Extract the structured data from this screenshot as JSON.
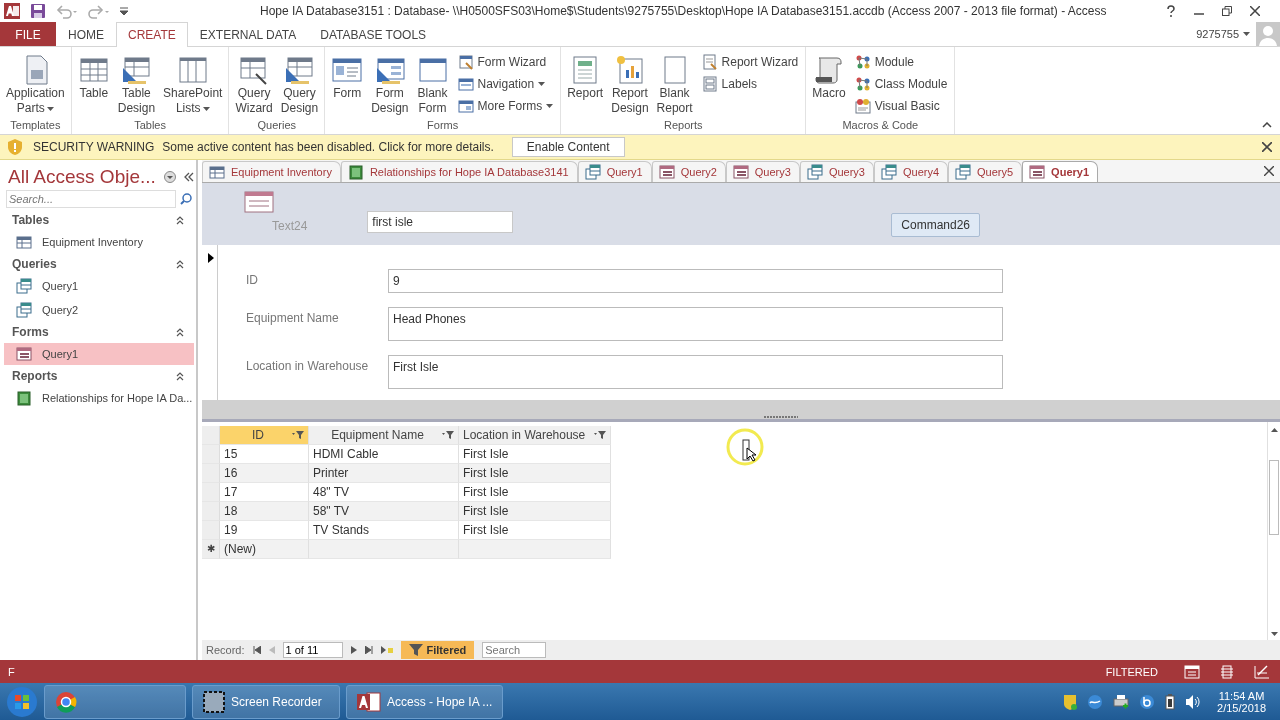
{
  "window": {
    "title": "Hope IA Database3151 : Database- \\\\H0500SFS03\\Home$\\Students\\9275755\\Desktop\\Hope IA Database3151.accdb (Access 2007 - 2013 file format) - Access",
    "user": "9275755"
  },
  "ribbon_tabs": [
    {
      "label": "FILE",
      "kind": "file",
      "selected": false
    },
    {
      "label": "HOME",
      "kind": "tab",
      "selected": false
    },
    {
      "label": "CREATE",
      "kind": "tab",
      "selected": true
    },
    {
      "label": "EXTERNAL DATA",
      "kind": "tab",
      "selected": false
    },
    {
      "label": "DATABASE TOOLS",
      "kind": "tab",
      "selected": false
    }
  ],
  "ribbon_groups": [
    {
      "label": "Templates",
      "large": [
        {
          "label": "Application\nParts",
          "dropdown": true,
          "kind": "parts"
        }
      ]
    },
    {
      "label": "Tables",
      "large": [
        {
          "label": "Table",
          "dropdown": false,
          "kind": "table"
        },
        {
          "label": "Table\nDesign",
          "dropdown": false,
          "kind": "tabledesign"
        },
        {
          "label": "SharePoint\nLists",
          "dropdown": true,
          "kind": "lists"
        }
      ]
    },
    {
      "label": "Queries",
      "large": [
        {
          "label": "Query\nWizard",
          "dropdown": false,
          "kind": "querywizard"
        },
        {
          "label": "Query\nDesign",
          "dropdown": false,
          "kind": "tabledesign"
        }
      ]
    },
    {
      "label": "Forms",
      "large": [
        {
          "label": "Form",
          "dropdown": false,
          "kind": "form"
        },
        {
          "label": "Form\nDesign",
          "dropdown": false,
          "kind": "formdesign"
        },
        {
          "label": "Blank\nForm",
          "dropdown": false,
          "kind": "blank"
        }
      ],
      "small": [
        {
          "label": "Form Wizard",
          "dropdown": false
        },
        {
          "label": "Navigation",
          "dropdown": true
        },
        {
          "label": "More Forms",
          "dropdown": true
        }
      ]
    },
    {
      "label": "Reports",
      "large": [
        {
          "label": "Report",
          "dropdown": false,
          "kind": "report"
        },
        {
          "label": "Report\nDesign",
          "dropdown": false,
          "kind": "reportdesign"
        },
        {
          "label": "Blank\nReport",
          "dropdown": false,
          "kind": "blankreport"
        }
      ],
      "small": [
        {
          "label": "Report Wizard",
          "dropdown": false
        },
        {
          "label": "Labels",
          "dropdown": false
        }
      ]
    },
    {
      "label": "Macros & Code",
      "large": [
        {
          "label": "Macro",
          "dropdown": false,
          "kind": "macro"
        }
      ],
      "small": [
        {
          "label": "Module",
          "dropdown": false
        },
        {
          "label": "Class Module",
          "dropdown": false
        },
        {
          "label": "Visual Basic",
          "dropdown": false
        }
      ]
    }
  ],
  "security_bar": {
    "title": "SECURITY WARNING",
    "message": "Some active content has been disabled. Click for more details.",
    "button": "Enable Content"
  },
  "nav_pane": {
    "title": "All Access Obje...",
    "search_placeholder": "Search...",
    "groups": [
      {
        "label": "Tables",
        "items": [
          {
            "label": "Equipment Inventory",
            "kind": "table",
            "selected": false
          }
        ]
      },
      {
        "label": "Queries",
        "items": [
          {
            "label": "Query1",
            "kind": "query",
            "selected": false
          },
          {
            "label": "Query2",
            "kind": "query",
            "selected": false
          }
        ]
      },
      {
        "label": "Forms",
        "items": [
          {
            "label": "Query1",
            "kind": "form",
            "selected": true
          }
        ]
      },
      {
        "label": "Reports",
        "items": [
          {
            "label": "Relationships for Hope IA Da...",
            "kind": "report",
            "selected": false
          }
        ]
      }
    ]
  },
  "doc_tabs": [
    {
      "label": "Equipment Inventory",
      "kind": "table",
      "selected": false
    },
    {
      "label": "Relationships for Hope IA Database3141",
      "kind": "report",
      "selected": false
    },
    {
      "label": "Query1",
      "kind": "query",
      "selected": false
    },
    {
      "label": "Query2",
      "kind": "form",
      "selected": false
    },
    {
      "label": "Query3",
      "kind": "form",
      "selected": false
    },
    {
      "label": "Query3",
      "kind": "query",
      "selected": false
    },
    {
      "label": "Query4",
      "kind": "query",
      "selected": false
    },
    {
      "label": "Query5",
      "kind": "query",
      "selected": false
    },
    {
      "label": "Query1",
      "kind": "form",
      "selected": true
    }
  ],
  "form": {
    "header": {
      "label": "Text24",
      "value": "first isle",
      "button": "Command26"
    },
    "fields": [
      {
        "label": "ID",
        "value": "9",
        "tall": false
      },
      {
        "label": "Equipment Name",
        "value": "Head Phones",
        "tall": true
      },
      {
        "label": "Location in Warehouse",
        "value": "First Isle",
        "tall": true
      }
    ]
  },
  "datasheet": {
    "columns": [
      {
        "label": "ID",
        "selected": true
      },
      {
        "label": "Equipment Name",
        "selected": false
      },
      {
        "label": "Location in Warehouse",
        "selected": false
      }
    ],
    "rows": [
      [
        "15",
        "HDMI Cable",
        "First Isle"
      ],
      [
        "16",
        "Printer",
        "First Isle"
      ],
      [
        "17",
        "48\" TV",
        "First Isle"
      ],
      [
        "18",
        "58\" TV",
        "First Isle"
      ],
      [
        "19",
        "TV Stands",
        "First Isle"
      ]
    ],
    "new_row": {
      "marker": "✱",
      "label": "(New)"
    }
  },
  "record_nav": {
    "label": "Record:",
    "position": "1 of 11",
    "filter": "Filtered",
    "search_placeholder": "Search"
  },
  "status_bar": {
    "left": "F",
    "right": "FILTERED"
  },
  "taskbar": {
    "items": [
      {
        "kind": "chrome"
      },
      {
        "label": "Screen Recorder",
        "kind": "recorder"
      },
      {
        "label": "Access - Hope IA ...",
        "kind": "access"
      }
    ],
    "time": "11:54 AM",
    "date": "2/15/2018"
  }
}
